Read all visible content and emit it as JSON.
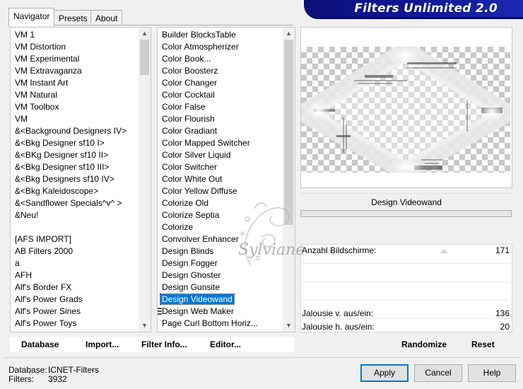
{
  "window": {
    "banner_title": "Filters Unlimited 2.0"
  },
  "tabs": [
    {
      "label": "Navigator",
      "active": true
    },
    {
      "label": "Presets",
      "active": false
    },
    {
      "label": "About",
      "active": false
    }
  ],
  "category_list": {
    "items": [
      "VM 1",
      "VM Distortion",
      "VM Experimental",
      "VM Extravaganza",
      "VM Instant Art",
      "VM Natural",
      "VM Toolbox",
      "VM",
      "&<Background Designers IV>",
      "&<Bkg Designer sf10 I>",
      "&<BKg Designer sf10 II>",
      "&<Bkg Designer sf10 III>",
      "&<Bkg Designers sf10 IV>",
      "&<Bkg Kaleidoscope>",
      "&<Sandflower Specials^v^ >",
      "&Neu!",
      "",
      "[AFS IMPORT]",
      "AB Filters 2000",
      "a",
      "AFH",
      "Alf's Border FX",
      "Alf's Power Grads",
      "Alf's Power Sines",
      "Alf's Power Toys"
    ]
  },
  "filter_list": {
    "items": [
      "Builder BlocksTable",
      "Color Atmospherizer",
      "Color Book...",
      "Color Boosterz",
      "Color Changer",
      "Color Cocktail",
      "Color False",
      "Color Flourish",
      "Color Gradiant",
      "Color Mapped Switcher",
      "Color Silver Liquid",
      "Color Switcher",
      "Color White Out",
      "Color Yellow Diffuse",
      "Colorize Old",
      "Colorize Septia",
      "Colorize",
      "Convolver Enhancer",
      "Design Blinds",
      "Design Fogger",
      "Design Ghoster",
      "Design Gunsite",
      "Design Videowand",
      "Design Web Maker",
      "Page Curl Bottom Horiz..."
    ],
    "selected": "Design Videowand"
  },
  "filter": {
    "name": "Design Videowand",
    "params": [
      {
        "label": "Anzahl Bildschirme:",
        "value": "171"
      },
      {
        "label": "Jalousie v. aus/ein:",
        "value": "136"
      },
      {
        "label": "Jalousie h. aus/ein:",
        "value": "20"
      }
    ]
  },
  "toolbar": {
    "database": "Database",
    "import": "Import...",
    "filter_info": "Filter Info...",
    "editor": "Editor...",
    "randomize": "Randomize",
    "reset": "Reset"
  },
  "footer": {
    "database_label": "Database:",
    "database_value": "ICNET-Filters",
    "filters_label": "Filters:",
    "filters_value": "3932"
  },
  "buttons": {
    "apply": "Apply",
    "cancel": "Cancel",
    "help": "Help"
  },
  "watermark_text": "Sylviane"
}
